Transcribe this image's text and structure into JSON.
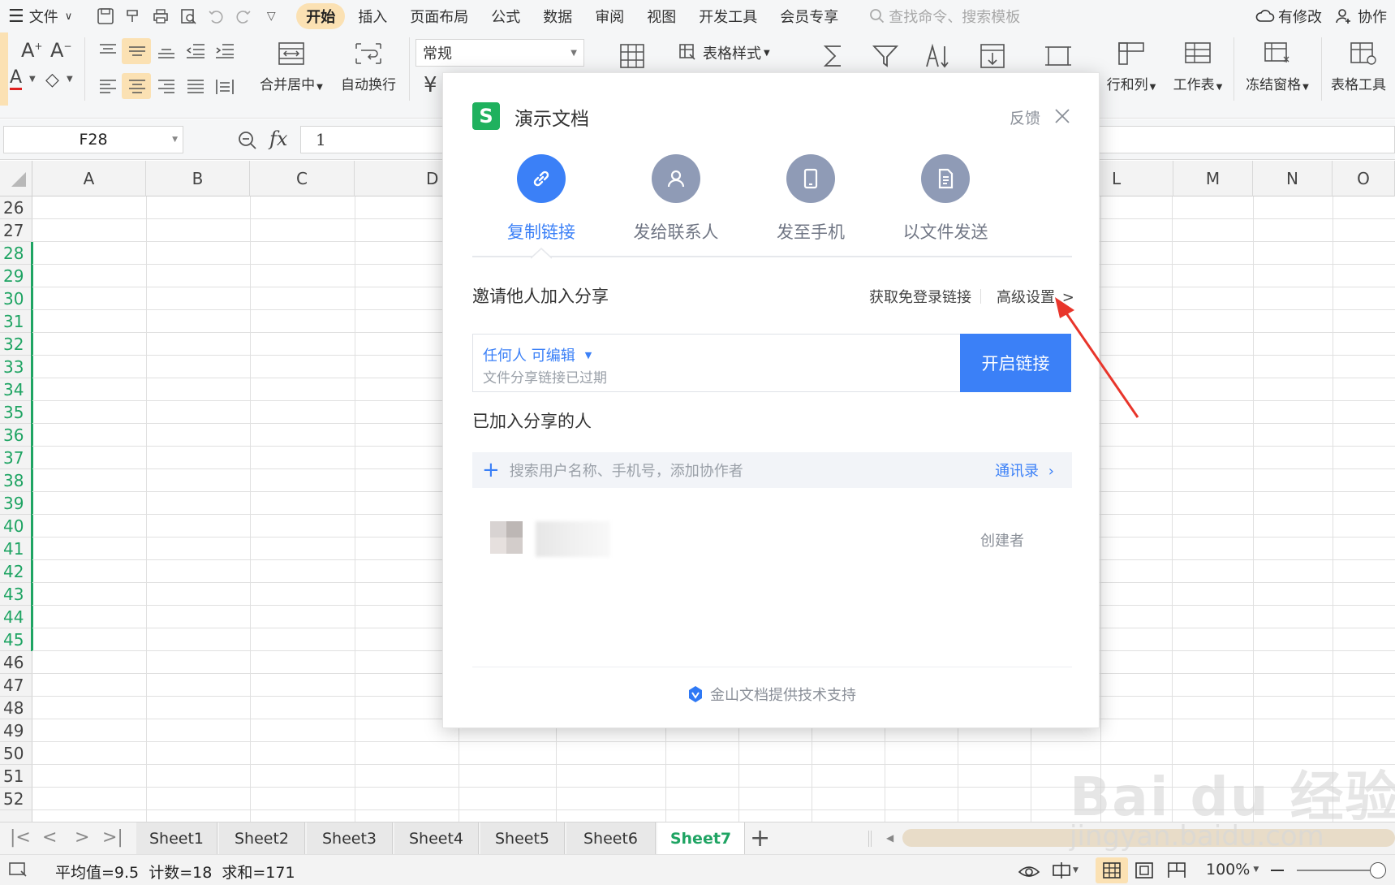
{
  "menubar": {
    "file_label": "文件",
    "tabs": [
      "开始",
      "插入",
      "页面布局",
      "公式",
      "数据",
      "审阅",
      "视图",
      "开发工具",
      "会员专享"
    ],
    "search_placeholder": "查找命令、搜索模板",
    "modified_label": "有修改",
    "collab_label": "协作"
  },
  "toolbar": {
    "merge_label": "合并居中",
    "wrap_label": "自动换行",
    "format_value": "常规",
    "table_style_label": "表格样式",
    "rowcol_label": "行和列",
    "sheet_label": "工作表",
    "freeze_label": "冻结窗格",
    "tabletools_label": "表格工具",
    "currency_symbol": "¥"
  },
  "formula_bar": {
    "cell_ref": "F28",
    "fx_label": "fx",
    "value": "1"
  },
  "grid": {
    "columns_left": [
      "A",
      "B",
      "C",
      "D"
    ],
    "columns_right": [
      "L",
      "M",
      "N",
      "O"
    ],
    "rows": [
      "26",
      "27",
      "28",
      "29",
      "30",
      "31",
      "32",
      "33",
      "34",
      "35",
      "36",
      "37",
      "38",
      "39",
      "40",
      "41",
      "42",
      "43",
      "44",
      "45",
      "46",
      "47",
      "48",
      "49",
      "50",
      "51",
      "52"
    ],
    "selected_rows": [
      "28",
      "29",
      "30",
      "31",
      "32",
      "33",
      "34",
      "35",
      "36",
      "37",
      "38",
      "39",
      "40",
      "41",
      "42",
      "43",
      "44",
      "45"
    ]
  },
  "sheet_tabs": {
    "tabs": [
      "Sheet1",
      "Sheet2",
      "Sheet3",
      "Sheet4",
      "Sheet5",
      "Sheet6",
      "Sheet7"
    ],
    "active": "Sheet7"
  },
  "status": {
    "summary": "平均值=9.5  计数=18  求和=171",
    "zoom": "100%"
  },
  "dialog": {
    "logo_letter": "S",
    "title": "演示文档",
    "feedback_label": "反馈",
    "options": [
      {
        "label": "复制链接",
        "icon": "link-icon",
        "active": true
      },
      {
        "label": "发给联系人",
        "icon": "contact-icon",
        "active": false
      },
      {
        "label": "发至手机",
        "icon": "phone-icon",
        "active": false
      },
      {
        "label": "以文件发送",
        "icon": "file-icon",
        "active": false
      }
    ],
    "invite_title": "邀请他人加入分享",
    "no_login_link": "获取免登录链接",
    "advanced_settings": "高级设置",
    "permission_label": "任何人 可编辑",
    "link_status": "文件分享链接已过期",
    "enable_link_button": "开启链接",
    "joined_title": "已加入分享的人",
    "search_placeholder": "搜索用户名称、手机号，添加协作者",
    "contacts_label": "通讯录",
    "creator_label": "创建者",
    "footer_text": "金山文档提供技术支持"
  },
  "watermark": {
    "brand": "Bai du 经验",
    "site": "jingyan.baidu.com"
  },
  "colors": {
    "accent_blue": "#3b80f7",
    "selection_green": "#1fa463",
    "active_tab_bg": "#fbe1b3",
    "annotation_red": "#e8352b",
    "option_icon_gray": "#8f9bb6"
  }
}
